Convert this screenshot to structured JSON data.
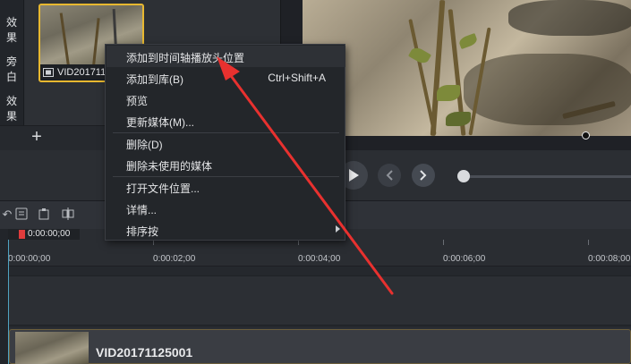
{
  "tool_tabs": [
    {
      "label": "效果"
    },
    {
      "label": "旁白"
    },
    {
      "label": "效果"
    }
  ],
  "media_bin": {
    "thumbnail": {
      "filename": "VID20171125001",
      "icon": "film-icon"
    },
    "add_button": "+"
  },
  "context_menu": {
    "items": [
      {
        "label": "添加到时间轴播放头位置",
        "shortcut": ""
      },
      {
        "label": "添加到库(B)",
        "shortcut": "Ctrl+Shift+A"
      },
      {
        "label": "预览",
        "shortcut": ""
      },
      {
        "label": "更新媒体(M)...",
        "shortcut": ""
      },
      {
        "label": "删除(D)",
        "shortcut": ""
      },
      {
        "label": "删除未使用的媒体",
        "shortcut": ""
      },
      {
        "label": "打开文件位置...",
        "shortcut": ""
      },
      {
        "label": "详情...",
        "shortcut": ""
      },
      {
        "label": "排序按",
        "shortcut": ""
      }
    ]
  },
  "playback": {
    "play_icon": "play-icon",
    "prev_icon": "previous-frame-icon",
    "next_icon": "next-frame-icon"
  },
  "timeline": {
    "playhead_time": "0:00:00;00",
    "ruler_ticks": [
      "0:00:00;00",
      "0:00:02;00",
      "0:00:04;00",
      "0:00:06;00",
      "0:00:08;00"
    ],
    "clip_label": "VID20171125001"
  },
  "annotation": {
    "color": "#e8312f"
  }
}
